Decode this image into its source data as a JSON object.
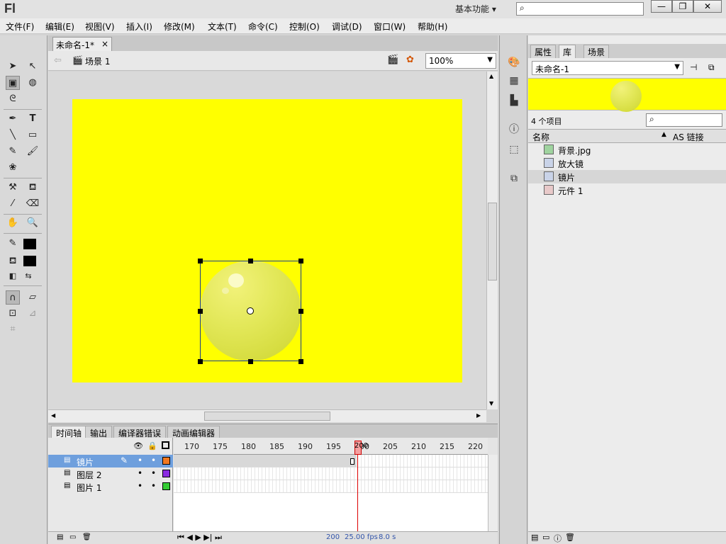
{
  "app": {
    "logo": "Fl",
    "workspace": "基本功能 ▾"
  },
  "window_controls": {
    "minimize": "—",
    "restore": "❐",
    "close": "✕"
  },
  "menu": [
    "文件(F)",
    "编辑(E)",
    "视图(V)",
    "插入(I)",
    "修改(M)",
    "文本(T)",
    "命令(C)",
    "控制(O)",
    "调试(D)",
    "窗口(W)",
    "帮助(H)"
  ],
  "document": {
    "tab_title": "未命名-1*",
    "tab_close": "×",
    "scene": "场景 1",
    "zoom": "100%"
  },
  "stage": {
    "background_color": "#ffff00",
    "symbol": "镜片"
  },
  "timeline": {
    "tabs": [
      "时间轴",
      "输出",
      "编译器错误",
      "动画编辑器"
    ],
    "ticks": [
      "170",
      "175",
      "180",
      "185",
      "190",
      "195",
      "200",
      "205",
      "210",
      "215",
      "220"
    ],
    "current_frame_label": "200",
    "layers": [
      {
        "name": "镜片",
        "color": "#f07820",
        "selected": true
      },
      {
        "name": "图层 2",
        "color": "#8a2be2",
        "selected": false
      },
      {
        "name": "图片 1",
        "color": "#33cc33",
        "selected": false
      }
    ],
    "status": {
      "frame": "200",
      "fps": "25.00 fps",
      "time": "8.0 s"
    }
  },
  "panel": {
    "tabs": [
      "属性",
      "库",
      "场景"
    ],
    "active_tab": "库",
    "library_select": "未命名-1",
    "item_count": "4 个项目",
    "col_name": "名称",
    "col_link": "AS 链接",
    "items": [
      {
        "name": "背景.jpg",
        "type": "bitmap"
      },
      {
        "name": "放大镜",
        "type": "graphic"
      },
      {
        "name": "镜片",
        "type": "graphic",
        "selected": true
      },
      {
        "name": "元件 1",
        "type": "movieclip"
      }
    ]
  }
}
